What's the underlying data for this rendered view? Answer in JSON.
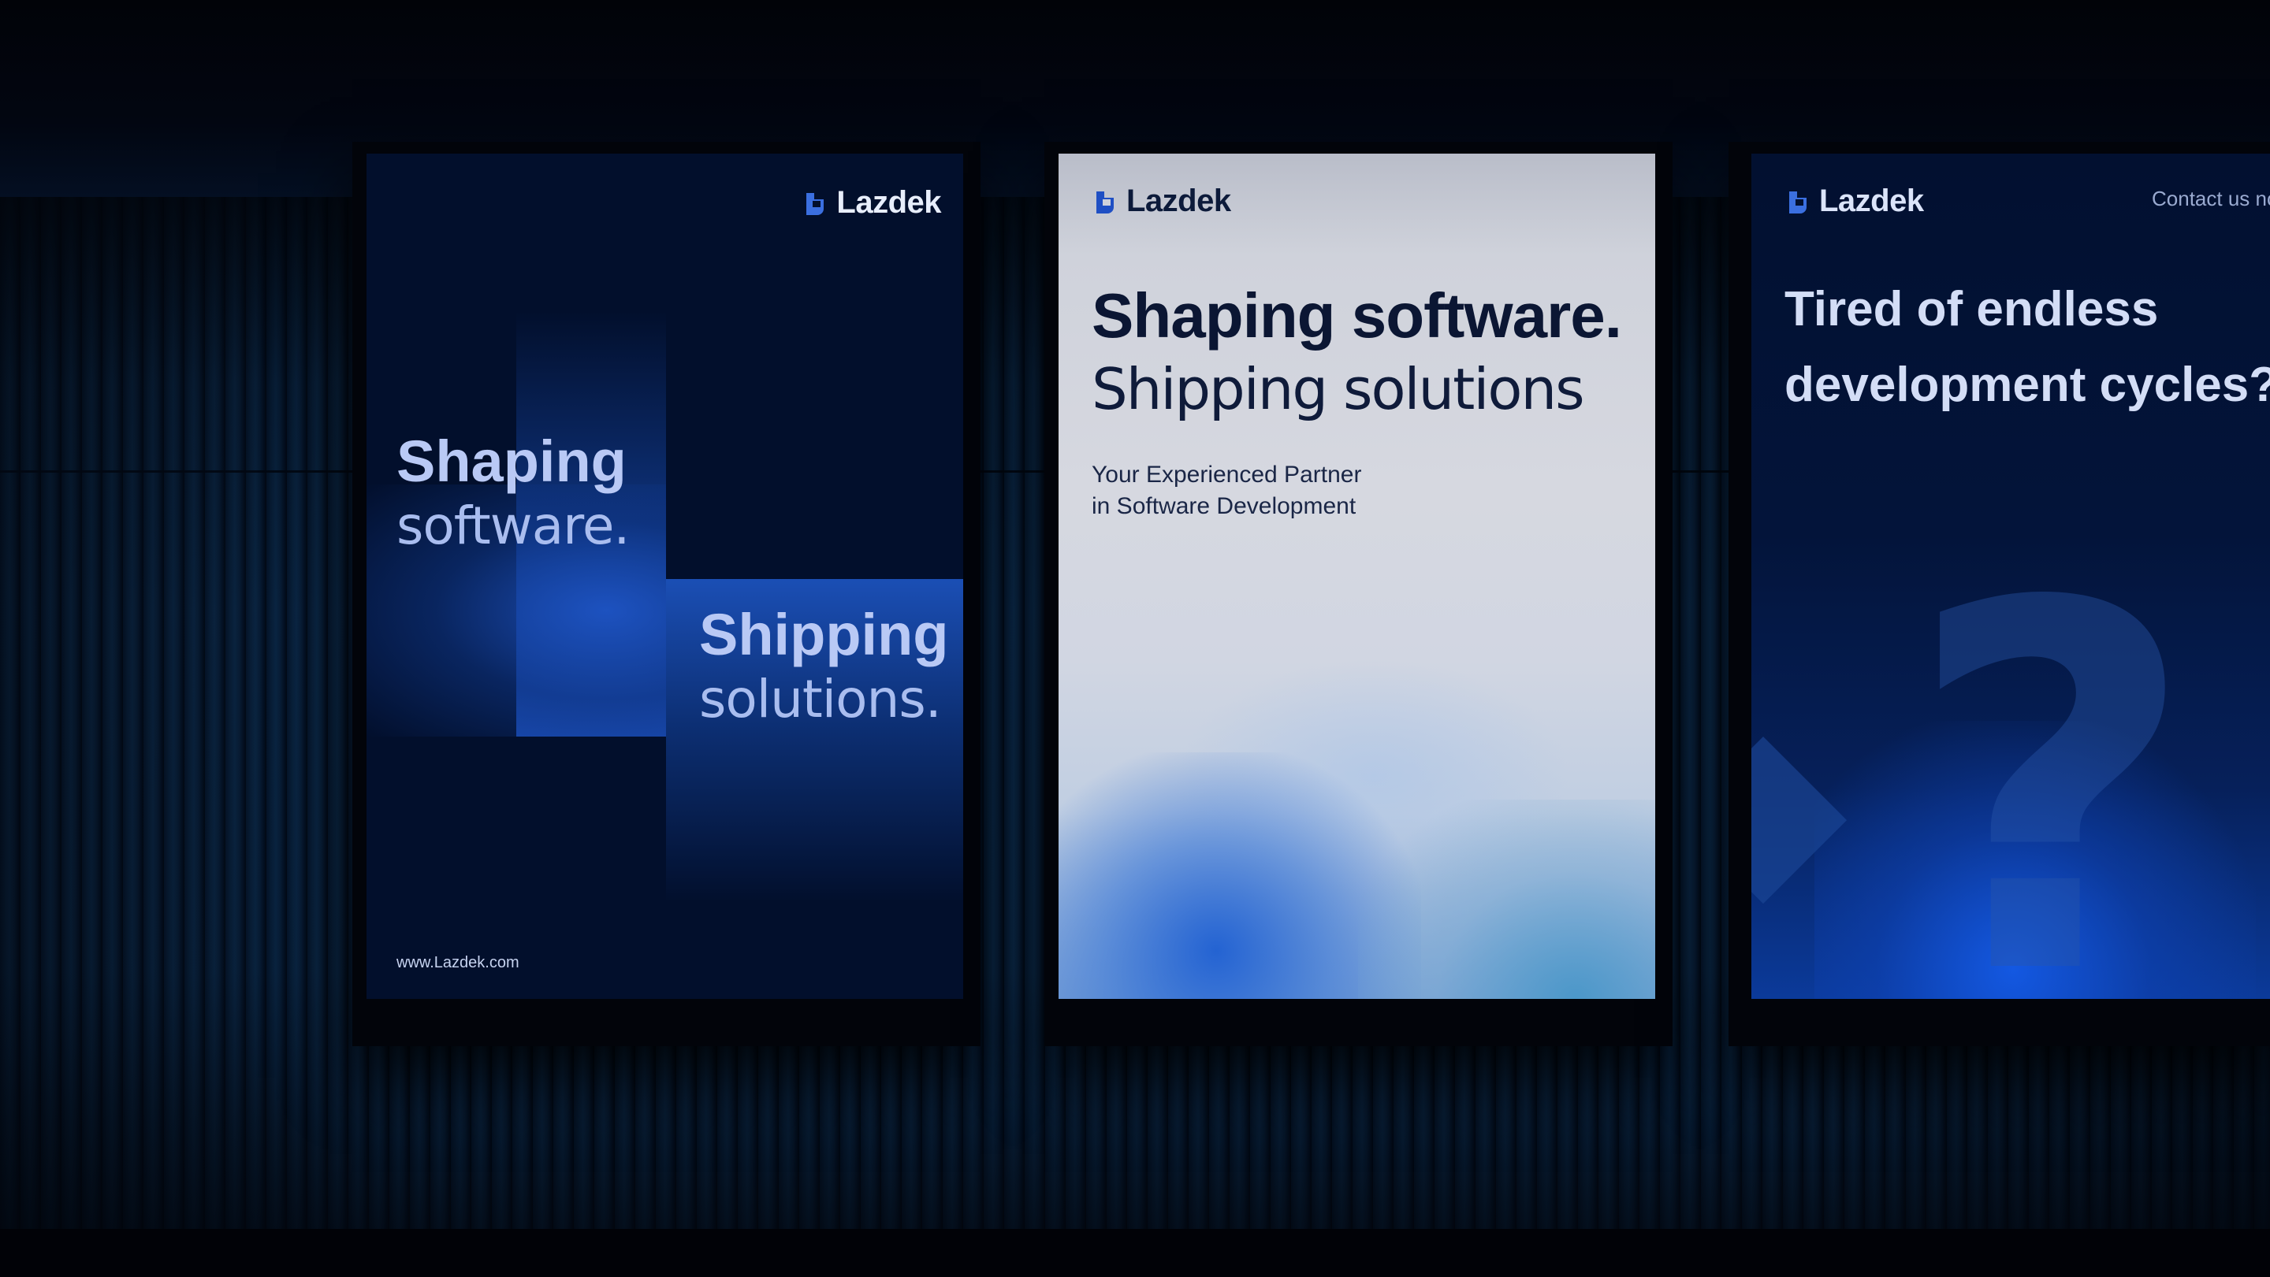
{
  "scene": {
    "description_colors": {
      "wall": "#0a2747",
      "accent_blue": "#1e54c4"
    }
  },
  "posters": {
    "left": {
      "brand": "Lazdek",
      "logo_icon": "lazdek-logo-icon",
      "headline_1_bold": "Shaping",
      "headline_1_light": "software.",
      "headline_2_bold": "Shipping",
      "headline_2_light": "solutions.",
      "url": "www.Lazdek.com"
    },
    "center": {
      "brand": "Lazdek",
      "logo_icon": "lazdek-logo-icon",
      "headline_bold": "Shaping software.",
      "headline_light": "Shipping solutions",
      "subline_1": "Your Experienced Partner",
      "subline_2": "in Software Development"
    },
    "right": {
      "brand": "Lazdek",
      "logo_icon": "lazdek-logo-icon",
      "contact": "Contact us no",
      "headline_line_1": "Tired of endless",
      "headline_line_2": "development cycles?",
      "graphic_glyph": "?"
    }
  }
}
